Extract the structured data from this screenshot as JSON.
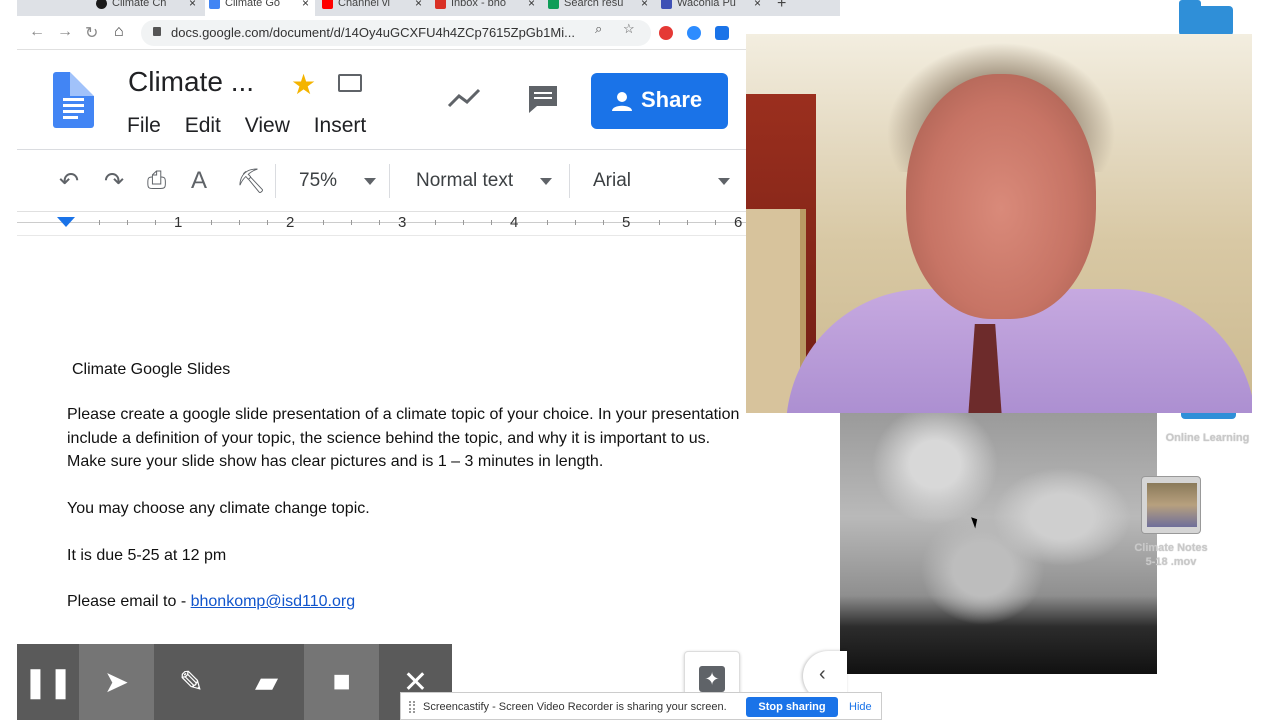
{
  "browser": {
    "tabs": [
      {
        "label": "Climate Ch",
        "icon_color": "#1a1a1a",
        "active": false
      },
      {
        "label": "Climate Go",
        "icon_color": "#4285f4",
        "active": true
      },
      {
        "label": "Channel vi",
        "icon_color": "#ff0000",
        "active": false
      },
      {
        "label": "Inbox - bho",
        "icon_color": "#d93025",
        "active": false
      },
      {
        "label": "Search resu",
        "icon_color": "#0f9d58",
        "active": false
      },
      {
        "label": "Waconia Pu",
        "icon_color": "#3f51b5",
        "active": false
      }
    ],
    "new_tab": "+",
    "url": "docs.google.com/document/d/14Oy4uGCXFU4h4ZCp7615ZpGb1Mi..."
  },
  "docs": {
    "title": "Climate ...",
    "menus": [
      "File",
      "Edit",
      "View",
      "Insert"
    ],
    "share_label": "Share",
    "accent": "#1a73e8"
  },
  "toolbar": {
    "zoom": "75%",
    "style": "Normal text",
    "font": "Arial"
  },
  "ruler": {
    "numbers": [
      "1",
      "2",
      "3",
      "4",
      "5",
      "6"
    ]
  },
  "document": {
    "heading": "Climate Google Slides",
    "paragraph1_line1": "Please create a google slide presentation of a climate topic of your choice. In your presentation",
    "paragraph1_line2": "include a definition of your topic, the science behind the topic, and why it is important to us.",
    "paragraph1_line3": "Make sure your slide show has clear pictures and is 1 – 3 minutes in length.",
    "paragraph2": "You may choose any climate change topic.",
    "paragraph3": "It is due 5-25 at 12 pm",
    "email_prefix": "Please email to - ",
    "email": "bhonkomp@isd110.org"
  },
  "desktop": {
    "folder_label": "Online Learning",
    "movie_label_line1": "Climate Notes",
    "movie_label_line2": "5-18 .mov"
  },
  "sharing_banner": {
    "message": "Screencastify - Screen Video Recorder is sharing your screen.",
    "stop_label": "Stop sharing",
    "hide_label": "Hide"
  }
}
